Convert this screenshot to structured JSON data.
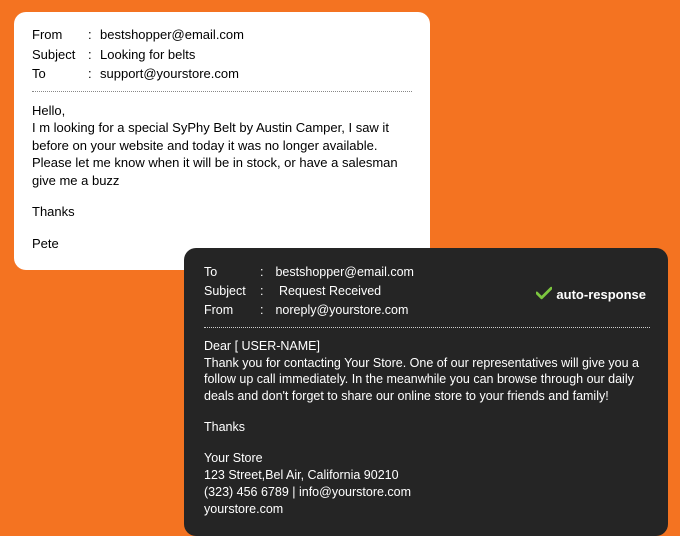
{
  "white": {
    "from_label": "From",
    "from_value": "bestshopper@email.com",
    "subject_label": "Subject",
    "subject_value": "Looking for belts",
    "to_label": "To",
    "to_value": "support@yourstore.com",
    "greeting": "Hello,",
    "body": "I m looking for a special SyPhy Belt by Austin Camper, I saw it before on your website and today it was no longer available. Please let me know when it will be in stock, or have a salesman give me a buzz",
    "thanks": "Thanks",
    "sign": "Pete"
  },
  "dark": {
    "to_label": "To",
    "to_value": "bestshopper@email.com",
    "subject_label": "Subject",
    "subject_value": "Request Received",
    "from_label": "From",
    "from_value": "noreply@yourstore.com",
    "auto_label": "auto-response",
    "greeting": "Dear [ USER-NAME]",
    "body": "Thank you for contacting Your Store. One of our representatives will give you a follow up call immediately. In the meanwhile you can browse through our daily deals and don't forget to share our online store to your friends and family!",
    "thanks": "Thanks",
    "store": "Your Store",
    "addr": "123 Street,Bel Air, California 90210",
    "phone_email": "(323) 456 6789 | info@yourstore.com",
    "site": "yourstore.com"
  }
}
